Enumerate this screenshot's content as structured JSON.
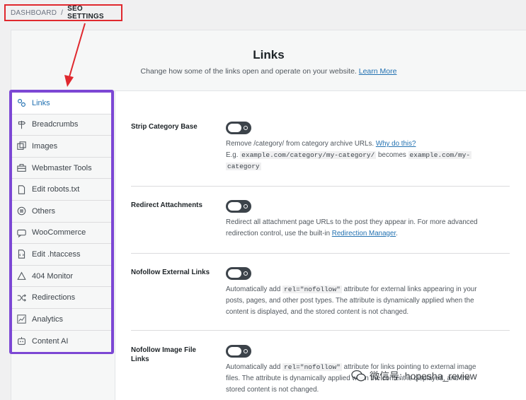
{
  "breadcrumb": {
    "parent": "DASHBOARD",
    "separator": "/",
    "current": "SEO SETTINGS"
  },
  "header": {
    "title": "Links",
    "subtitle": "Change how some of the links open and operate on your website.",
    "learn_more": "Learn More"
  },
  "sidebar": {
    "items": [
      {
        "label": "Links",
        "icon": "link-icon",
        "active": true
      },
      {
        "label": "Breadcrumbs",
        "icon": "signpost-icon"
      },
      {
        "label": "Images",
        "icon": "images-icon"
      },
      {
        "label": "Webmaster Tools",
        "icon": "toolbox-icon"
      },
      {
        "label": "Edit robots.txt",
        "icon": "file-icon"
      },
      {
        "label": "Others",
        "icon": "list-circle-icon"
      },
      {
        "label": "WooCommerce",
        "icon": "woocommerce-icon"
      },
      {
        "label": "Edit .htaccess",
        "icon": "file-code-icon"
      },
      {
        "label": "404 Monitor",
        "icon": "warning-icon"
      },
      {
        "label": "Redirections",
        "icon": "shuffle-icon"
      },
      {
        "label": "Analytics",
        "icon": "chart-icon"
      },
      {
        "label": "Content AI",
        "icon": "robot-icon"
      }
    ]
  },
  "settings": {
    "strip_category": {
      "label": "Strip Category Base",
      "desc_text": "Remove /category/ from category archive URLs.",
      "desc_link": "Why do this?",
      "example_prefix": "E.g.",
      "example_from": "example.com/category/my-category/",
      "example_mid": "becomes",
      "example_to_1": "example.com/my-",
      "example_to_2": "category"
    },
    "redirect_attachments": {
      "label": "Redirect Attachments",
      "desc_1": "Redirect all attachment page URLs to the post they appear in. For more advanced",
      "desc_2": "redirection control, use the built-in",
      "desc_link": "Redirection Manager",
      "desc_end": "."
    },
    "nofollow_external": {
      "label": "Nofollow External Links",
      "desc_1a": "Automatically add",
      "code": "rel=\"nofollow\"",
      "desc_1b": "attribute for external links appearing in your",
      "desc_2": "posts, pages, and other post types. The attribute is dynamically applied when the",
      "desc_3": "content is displayed, and the stored content is not changed."
    },
    "nofollow_image": {
      "label": "Nofollow Image File Links",
      "desc_1a": "Automatically add",
      "code": "rel=\"nofollow\"",
      "desc_1b": "attribute for links pointing to external image",
      "desc_2": "files. The attribute is dynamically applied when the content is displayed, and the",
      "desc_3": "stored content is not changed."
    }
  },
  "watermark": {
    "text": "微信号: hopesha_review"
  },
  "colors": {
    "highlight_red": "#e0282e",
    "highlight_purple": "#7c47d4",
    "link_blue": "#2271b1",
    "toggle_dark": "#3c434a"
  }
}
